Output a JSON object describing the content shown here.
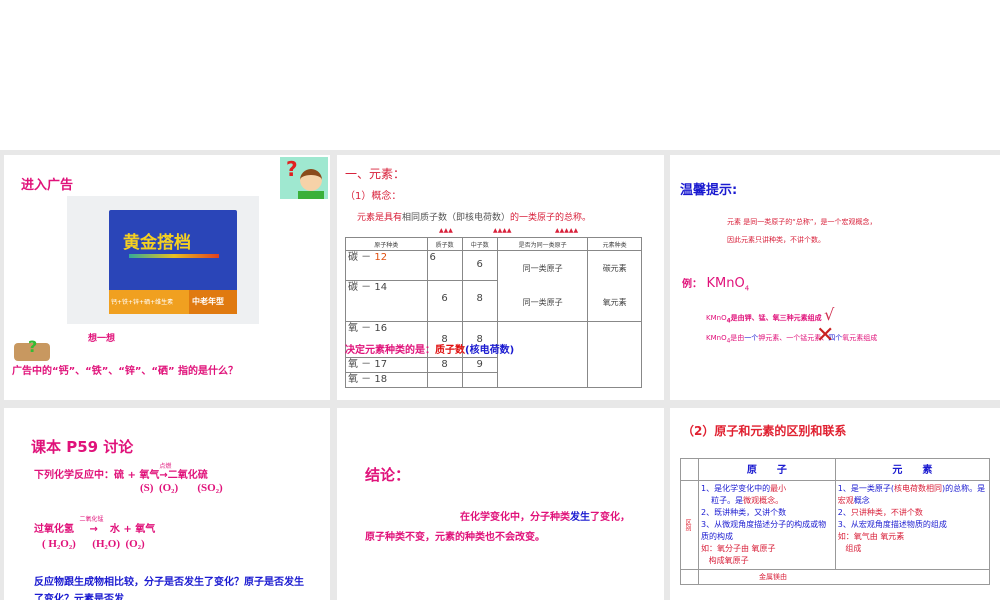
{
  "slides": [
    {
      "title": "进入广告",
      "product_name": "黄金搭档",
      "product_strip": "钙+铁+锌+硒+维生素",
      "product_badge": "中老年型",
      "think": "想一想",
      "question": "广告中的“钙”、“铁”、“锌”、“硒” 指的是什么？"
    },
    {
      "heading": "一、元素：",
      "sub": "（1）概念：",
      "definition_a": "元素是具有",
      "definition_b": "相同质子数（即核电荷数）",
      "definition_c": "的一类原子的总称。",
      "marks": [
        "▲▲▲",
        "▲▲▲▲",
        "▲▲▲▲▲"
      ],
      "table": {
        "headers": [
          "原子种类",
          "质子数",
          "中子数",
          "是否为同一类原子",
          "元素种类"
        ],
        "rows": [
          [
            "碳 －",
            "12",
            "6",
            "6"
          ],
          [
            "碳 － 14",
            "",
            "6",
            "8"
          ],
          [
            "氧 － 16",
            "",
            "8",
            "8"
          ],
          [
            "氧 － 17",
            "",
            "8",
            "9"
          ],
          [
            "氧 － 18",
            "",
            "",
            ""
          ]
        ],
        "same1": "同一类原子",
        "elem1": "碳元素",
        "same2": "同一类原子",
        "elem2": "氧元素"
      },
      "conclusion_a": "决定元素种类的是：",
      "conclusion_b": "质子数",
      "conclusion_c": "(核电荷数)"
    },
    {
      "title": "温馨提示:",
      "tip1": "元素 是同一类原子的“总称”，是一个宏观概念，",
      "tip2": "因此元素只讲种类，不讲个数。",
      "example_label": "例：",
      "formula": "KMnO",
      "sub4": "4",
      "line1": "是由钾、锰、氧三种元素组成",
      "check": "√",
      "line2a": "是由",
      "line2b": "一个",
      "line2c": "钾元素、",
      "line2d": "一个锰元素、",
      "line2e": "四个",
      "line2f": "氧元素组成"
    },
    {
      "title": "课本 P59 讨论",
      "r1": "下列化学反应中：硫 + 氧气",
      "r1_cond": "点燃",
      "r1_arrow": "→",
      "r1_prod": "二氧化硫",
      "r1_formulas": "(S)  (O₂)       (SO₂)",
      "r2": "过氧化氢",
      "r2_cond": "二氧化锰",
      "r2_arrow": "→",
      "r2_prod": "水 + 氧气",
      "r2_formulas": "( H₂O₂)      (H₂O)  (O₂)",
      "question": "反应物跟生成物相比较，分子是否发生了变化？原子是否发生了变化？元素是否发"
    },
    {
      "title": "结论：",
      "text_a": "在化学变化中，分子种类",
      "text_b": "发生",
      "text_c": "了变化，原子种类不变，元素的种类也不会改变。"
    },
    {
      "title": "（2）原子和元素的区别和联系",
      "col1": "原　　子",
      "col2": "元　　素",
      "row_label": "区别",
      "atom": [
        "1、是化学变化中的",
        "最小",
        "粒子。是",
        "微观概念。",
        "2、既讲种类，又讲个数",
        "3、从微观角度描述分子的构成或物质的构成",
        "如：氧分子由",
        "氧原子",
        "构成",
        "氧原子"
      ],
      "elem": [
        "1、是一类原子(",
        "核电荷数相同",
        ")的总称。是",
        "宏观",
        "概念",
        "2、",
        "只讲种类，不讲个数",
        "3、从宏观角度描述物质的组成",
        "如：氧气由",
        "氧元素",
        "组成"
      ],
      "next": "金属镁由"
    }
  ]
}
